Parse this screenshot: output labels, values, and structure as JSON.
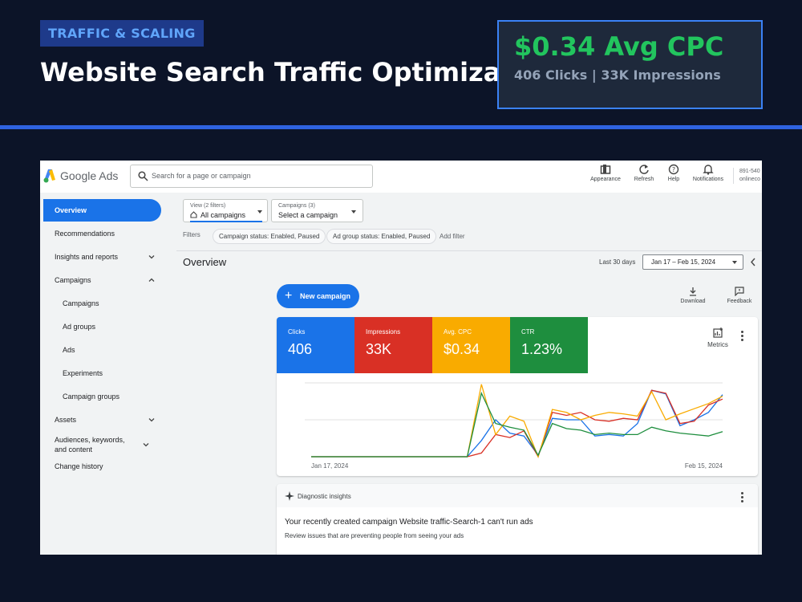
{
  "slide": {
    "tag": "TRAFFIC & SCALING",
    "title": "Website Search Traffic Optimization",
    "kpi_main": "$0.34 Avg CPC",
    "kpi_sub": "406 Clicks | 33K Impressions"
  },
  "app": {
    "brand": "Google Ads",
    "search_placeholder": "Search for a page or campaign",
    "tools": [
      {
        "label": "Appearance",
        "icon": "appearance-icon"
      },
      {
        "label": "Refresh",
        "icon": "refresh-icon"
      },
      {
        "label": "Help",
        "icon": "help-icon"
      },
      {
        "label": "Notifications",
        "icon": "bell-icon"
      }
    ],
    "account_line1": "891-540",
    "account_line2": "onlineco"
  },
  "sidebar": {
    "items": [
      {
        "label": "Overview"
      },
      {
        "label": "Recommendations"
      },
      {
        "label": "Insights and reports"
      },
      {
        "label": "Campaigns"
      },
      {
        "label": "Campaigns"
      },
      {
        "label": "Ad groups"
      },
      {
        "label": "Ads"
      },
      {
        "label": "Experiments"
      },
      {
        "label": "Campaign groups"
      },
      {
        "label": "Assets"
      },
      {
        "label": "Audiences, keywords, and content"
      },
      {
        "label": "Change history"
      }
    ]
  },
  "filters": {
    "view_small": "View (2 filters)",
    "view_value": "All campaigns",
    "campaigns_small": "Campaigns (3)",
    "campaigns_value": "Select a campaign",
    "label": "Filters",
    "chips": [
      "Campaign status: Enabled, Paused",
      "Ad group status: Enabled, Paused"
    ],
    "add_filter": "Add filter"
  },
  "overview": {
    "title": "Overview",
    "range_label": "Last 30 days",
    "date_range": "Jan 17 – Feb 15, 2024",
    "new_campaign": "New campaign",
    "download": "Download",
    "feedback": "Feedback"
  },
  "metrics": {
    "tiles": [
      {
        "label": "Clicks",
        "value": "406",
        "color": "#1a73e8"
      },
      {
        "label": "Impressions",
        "value": "33K",
        "color": "#d93025"
      },
      {
        "label": "Avg. CPC",
        "value": "$0.34",
        "color": "#f9ab00"
      },
      {
        "label": "CTR",
        "value": "1.23%",
        "color": "#1e8e3e"
      }
    ],
    "metrics_button": "Metrics"
  },
  "chart_data": {
    "type": "line",
    "x_start_label": "Jan 17, 2024",
    "x_end_label": "Feb 15, 2024",
    "x": [
      "Jan 17",
      "Jan 18",
      "Jan 19",
      "Jan 20",
      "Jan 21",
      "Jan 22",
      "Jan 23",
      "Jan 24",
      "Jan 25",
      "Jan 26",
      "Jan 27",
      "Jan 28",
      "Jan 29",
      "Jan 30",
      "Jan 31",
      "Feb 1",
      "Feb 2",
      "Feb 3",
      "Feb 4",
      "Feb 5",
      "Feb 6",
      "Feb 7",
      "Feb 8",
      "Feb 9",
      "Feb 10",
      "Feb 11",
      "Feb 12",
      "Feb 13",
      "Feb 14",
      "Feb 15"
    ],
    "grid": true,
    "series": [
      {
        "color": "#1a73e8",
        "values": [
          0,
          0,
          0,
          0,
          0,
          0,
          0,
          0,
          0,
          0,
          0,
          0,
          0.22,
          0.5,
          0.32,
          0.28,
          0.02,
          0.52,
          0.5,
          0.5,
          0.28,
          0.3,
          0.28,
          0.45,
          0.9,
          0.85,
          0.42,
          0.5,
          0.6,
          0.84
        ]
      },
      {
        "color": "#d93025",
        "values": [
          0,
          0,
          0,
          0,
          0,
          0,
          0,
          0,
          0,
          0,
          0,
          0,
          0.05,
          0.3,
          0.26,
          0.35,
          0.0,
          0.6,
          0.56,
          0.6,
          0.5,
          0.48,
          0.52,
          0.5,
          0.9,
          0.86,
          0.45,
          0.48,
          0.7,
          0.78
        ]
      },
      {
        "color": "#f9ab00",
        "values": [
          0,
          0,
          0,
          0,
          0,
          0,
          0,
          0,
          0,
          0,
          0,
          0,
          0.98,
          0.3,
          0.55,
          0.48,
          0.0,
          0.64,
          0.6,
          0.5,
          0.56,
          0.6,
          0.58,
          0.55,
          0.88,
          0.5,
          0.58,
          0.65,
          0.72,
          0.82
        ]
      },
      {
        "color": "#1e8e3e",
        "values": [
          0,
          0,
          0,
          0,
          0,
          0,
          0,
          0,
          0,
          0,
          0,
          0,
          0.86,
          0.45,
          0.4,
          0.36,
          0.02,
          0.45,
          0.38,
          0.36,
          0.3,
          0.32,
          0.3,
          0.3,
          0.4,
          0.35,
          0.32,
          0.3,
          0.28,
          0.34
        ]
      }
    ]
  },
  "insights": {
    "title": "Diagnostic insights",
    "headline": "Your recently created campaign Website traffic-Search-1 can't run ads",
    "text": "Review issues that are preventing people from seeing your ads"
  }
}
